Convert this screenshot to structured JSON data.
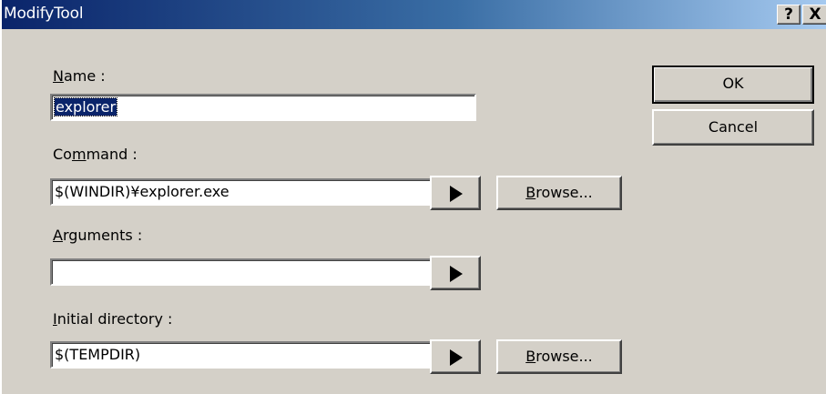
{
  "window": {
    "title": "ModifyTool",
    "help_label": "?",
    "close_label": "X"
  },
  "fields": {
    "name": {
      "label_prefix": "",
      "label_mnemonic": "N",
      "label_rest": "ame :",
      "value": "explorer"
    },
    "command": {
      "label_prefix": "Co",
      "label_mnemonic": "m",
      "label_rest": "mand :",
      "value": "$(WINDIR)¥explorer.exe"
    },
    "arguments": {
      "label_prefix": "",
      "label_mnemonic": "A",
      "label_rest": "rguments :",
      "value": ""
    },
    "initial_directory": {
      "label_prefix": "",
      "label_mnemonic": "I",
      "label_rest": "nitial directory :",
      "value": "$(TEMPDIR)"
    }
  },
  "buttons": {
    "ok": "OK",
    "cancel": "Cancel",
    "browse_mnemonic": "B",
    "browse_rest": "rowse..."
  },
  "icons": {
    "arrow": "right-triangle-icon"
  }
}
